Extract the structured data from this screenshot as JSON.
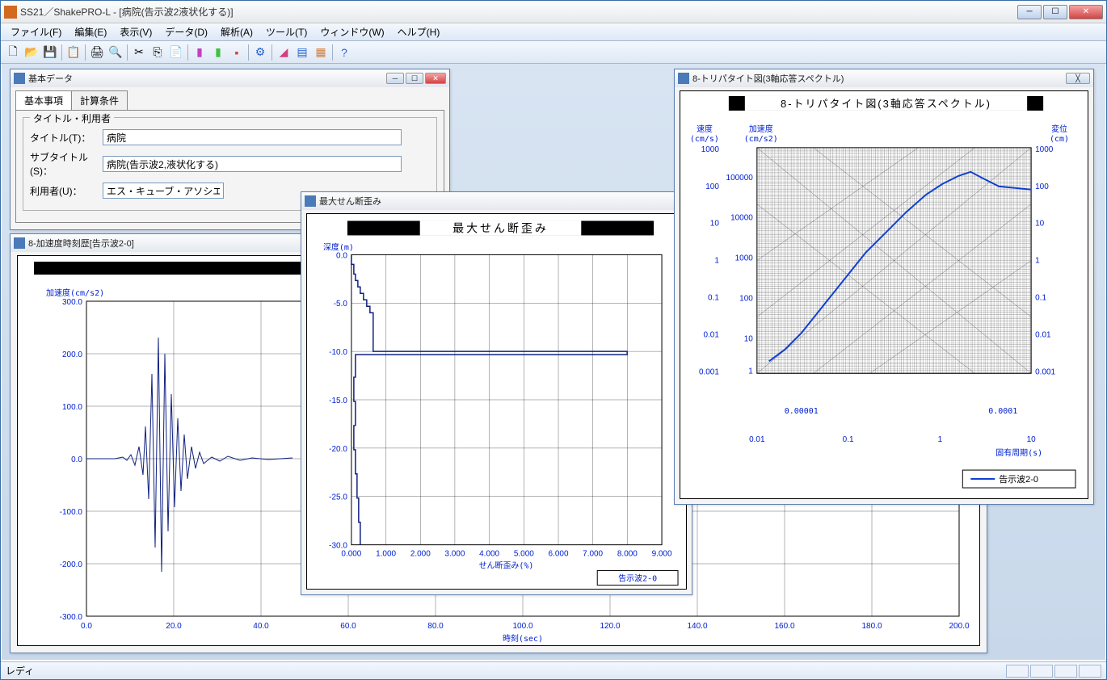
{
  "window": {
    "title": "SS21／ShakePRO-L - [病院(告示波2液状化する)]"
  },
  "menu": {
    "file": "ファイル(F)",
    "edit": "編集(E)",
    "view": "表示(V)",
    "data": "データ(D)",
    "analysis": "解析(A)",
    "tools": "ツール(T)",
    "window": "ウィンドウ(W)",
    "help": "ヘルプ(H)"
  },
  "statusbar": {
    "text": "レディ"
  },
  "basic_data_window": {
    "title": "基本データ",
    "tabs": {
      "basic": "基本事項",
      "calc": "計算条件"
    },
    "group_label": "タイトル・利用者",
    "labels": {
      "title": "タイトル(T)：",
      "subtitle": "サブタイトル(S)：",
      "user": "利用者(U)："
    },
    "values": {
      "title": "病院",
      "subtitle": "病院(告示波2,液状化する)",
      "user": "エス・キューブ・アソシエイツ"
    }
  },
  "accel_window": {
    "title": "8-加速度時刻歴[告示波2-0]"
  },
  "shear_window": {
    "title": "最大せん断歪み",
    "chart_title": "最大せん断歪み",
    "legend": "告示波2-0"
  },
  "tripartite_window": {
    "title": "8-トリパタイト図(3軸応答スペクトル)",
    "chart_title": "8-トリパタイト図(3軸応答スペクトル)",
    "legend": "告示波2-0",
    "axis_v": "速度\n(cm/s)",
    "axis_a": "加速度\n(cm/s2)",
    "axis_d": "変位\n(cm)",
    "axis_x": "固有周期(s)"
  },
  "chart_data": [
    {
      "type": "line",
      "name": "acceleration_time_history",
      "title": "",
      "xlabel": "時刻(sec)",
      "ylabel": "加速度(cm/s2)",
      "xlim": [
        0,
        200
      ],
      "ylim": [
        -300,
        300
      ],
      "x_ticks": [
        0,
        20,
        40,
        60,
        80,
        100,
        120,
        140,
        160,
        180,
        200
      ],
      "y_ticks": [
        -300,
        -200,
        -100,
        0,
        100,
        200,
        300
      ],
      "series": [
        {
          "name": "告示波2-0",
          "color": "#102080",
          "note": "seismic waveform; peak ~+230 at t≈17s, peak ~-210 at t≈19s; quiet until ~10s, intense 12–30s then decaying noise"
        }
      ]
    },
    {
      "type": "line",
      "name": "max_shear_strain_vs_depth",
      "title": "最大せん断歪み",
      "xlabel": "せん断歪み(%)",
      "ylabel": "深度(m)",
      "xlim": [
        0,
        9
      ],
      "ylim": [
        -30,
        0
      ],
      "x_ticks": [
        0,
        1,
        2,
        3,
        4,
        5,
        6,
        7,
        8,
        9
      ],
      "y_ticks": [
        0,
        -5,
        -10,
        -15,
        -20,
        -25,
        -30
      ],
      "series": [
        {
          "name": "告示波2-0",
          "color": "#102080",
          "x": [
            0.0,
            0.05,
            0.1,
            0.15,
            0.2,
            0.25,
            0.3,
            0.35,
            0.45,
            0.55,
            8.0,
            0.15,
            0.1,
            0.12,
            0.1,
            0.12,
            0.14,
            0.16,
            0.18,
            0.2
          ],
          "y": [
            0.0,
            -1.0,
            -2.0,
            -2.5,
            -3.0,
            -3.5,
            -4.0,
            -4.5,
            -5.0,
            -6.0,
            -10.0,
            -12.0,
            -14.0,
            -16.0,
            -18.0,
            -20.0,
            -22.0,
            -24.0,
            -26.0,
            -28.0
          ]
        }
      ]
    },
    {
      "type": "line",
      "name": "tripartite_response_spectrum",
      "title": "8-トリパタイト図(3軸応答スペクトル)",
      "xlabel": "固有周期(s)",
      "ylabel": "速度(cm/s)",
      "xscale": "log",
      "yscale": "log",
      "xlim": [
        0.01,
        10
      ],
      "ylim": [
        0.001,
        1000
      ],
      "x_ticks": [
        0.01,
        0.1,
        1,
        10
      ],
      "y_ticks_velocity": [
        0.001,
        0.01,
        0.1,
        1,
        10,
        100,
        1000
      ],
      "y_ticks_accel": [
        1,
        10,
        100,
        1000,
        10000,
        100000
      ],
      "y_ticks_disp_right": [
        0.001,
        0.01,
        0.1,
        1,
        10,
        100,
        1000
      ],
      "bottom_ticks_left": [
        1e-05
      ],
      "bottom_ticks_right": [
        0.0001
      ],
      "series": [
        {
          "name": "告示波2-0",
          "color": "#1040d0",
          "x": [
            0.02,
            0.03,
            0.05,
            0.08,
            0.1,
            0.15,
            0.2,
            0.3,
            0.5,
            0.8,
            1.0,
            1.5,
            2.0,
            3.0,
            5.0,
            8.0,
            10.0
          ],
          "y": [
            0.05,
            0.1,
            0.3,
            0.8,
            1.5,
            3.0,
            6.0,
            12.0,
            30.0,
            60.0,
            90.0,
            130.0,
            150.0,
            120.0,
            90.0,
            85.0,
            80.0
          ]
        }
      ]
    }
  ]
}
